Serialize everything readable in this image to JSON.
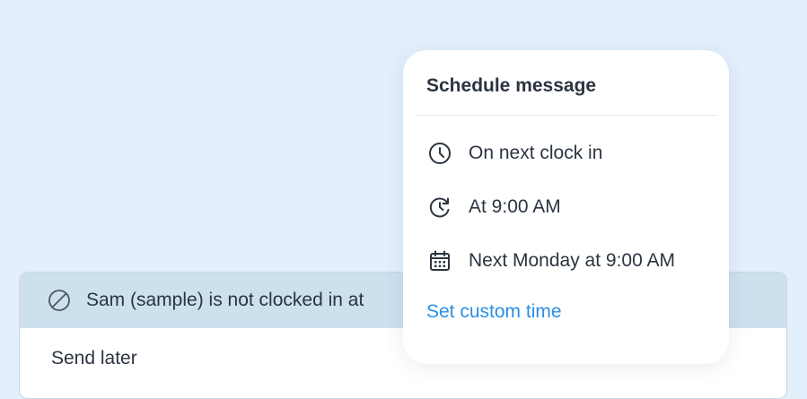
{
  "banner": {
    "text": "Sam (sample) is not clocked in at",
    "icon": "blocked-icon"
  },
  "composer": {
    "send_later_label": "Send later"
  },
  "schedule_popup": {
    "title": "Schedule message",
    "options": [
      {
        "label": "On next clock in",
        "icon": "clock-icon"
      },
      {
        "label": "At 9:00 AM",
        "icon": "clock-refresh-icon"
      },
      {
        "label": "Next Monday at 9:00 AM",
        "icon": "calendar-icon"
      }
    ],
    "custom_label": "Set custom time"
  },
  "colors": {
    "background": "#e3effb",
    "banner": "#cde0ee",
    "link": "#2a8fe6",
    "text": "#2b3440"
  }
}
